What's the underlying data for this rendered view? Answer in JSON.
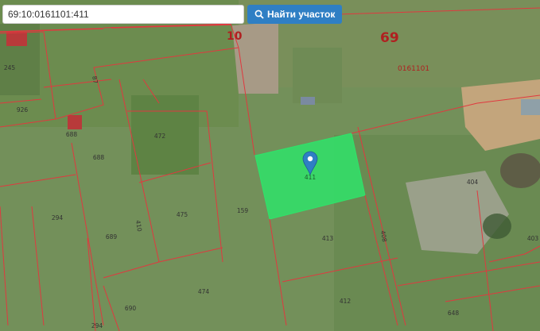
{
  "search": {
    "value": "69:10:0161101:411",
    "button_label": "Найти участок"
  },
  "map": {
    "district_label": "69",
    "district_sub_label": "10",
    "quarter_label": "0161101",
    "selected_plot_label": "411",
    "plot_labels": {
      "p245": "245",
      "p926": "926",
      "p688a": "688",
      "p688b": "688",
      "p472": "472",
      "p294a": "294",
      "p689": "689",
      "p475": "475",
      "p159": "159",
      "p413": "413",
      "p404": "404",
      "p403": "403",
      "p474": "474",
      "p412": "412",
      "p690": "690",
      "p294b": "294",
      "p648": "648",
      "p410": "410",
      "p408": "408",
      "p87": "87"
    },
    "colors": {
      "boundary": "#e0393f",
      "selected_fill": "#2fe36a",
      "marker": "#2f7fc4"
    }
  }
}
